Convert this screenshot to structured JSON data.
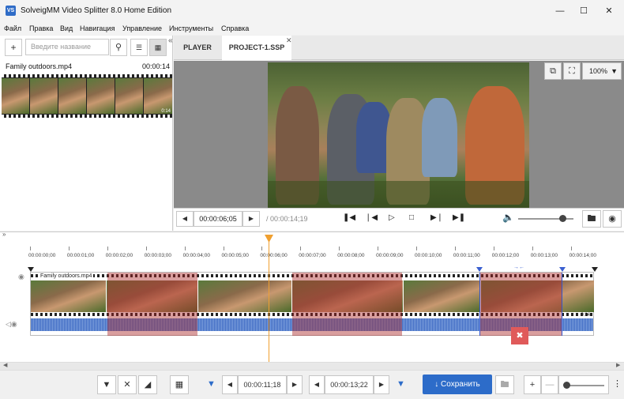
{
  "window": {
    "title": "SolveigMM Video Splitter 8.0 Home Edition",
    "icon_text": "VS"
  },
  "menu": [
    "Файл",
    "Правка",
    "Вид",
    "Навигация",
    "Управление",
    "Инструменты",
    "Справка"
  ],
  "library": {
    "search_placeholder": "Введите название",
    "clip": {
      "name": "Family outdoors.mp4",
      "duration": "00:00:14",
      "thumb_time": "0:14"
    }
  },
  "tabs": [
    {
      "label": "PLAYER"
    },
    {
      "label": "PROJECT-1.SSP"
    }
  ],
  "video_tools": {
    "zoom": "100%"
  },
  "player": {
    "current_time": "00:00:06;05",
    "total_time": "/ 00:00:14;19",
    "volume": 0.8
  },
  "timeline": {
    "ticks": [
      "00:00:00;00",
      "00:00:01;00",
      "00:00:02;00",
      "00:00:03;00",
      "00:00:04;00",
      "00:00:05;00",
      "00:00:06;00",
      "00:00:07;00",
      "00:00:08;00",
      "00:00:09;00",
      "00:00:10;00",
      "00:00:11;00",
      "00:00:12;00",
      "00:00:13;00",
      "00:00:14;00"
    ],
    "track_label": "Family outdoors.mp4",
    "end_label": "0:14"
  },
  "bottom": {
    "marker_in": "00:00:11;18",
    "marker_out": "00:00:13;22",
    "save_label": "Сохранить"
  }
}
